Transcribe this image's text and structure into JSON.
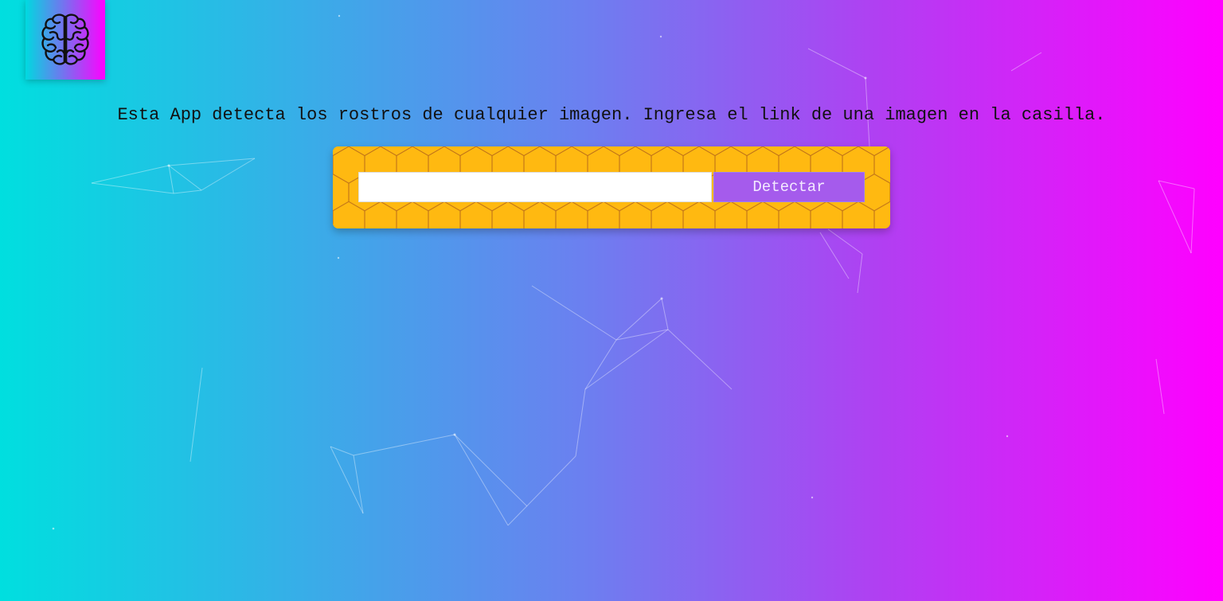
{
  "logo": {
    "icon": "brain-icon"
  },
  "intro_text": "Esta App detecta los rostros de cualquier imagen. Ingresa el link de una imagen en la casilla.",
  "form": {
    "url_value": "",
    "url_placeholder": "",
    "detect_label": "Detectar"
  },
  "colors": {
    "background_start": "#00dfdf",
    "background_end": "#ff00ff",
    "form_background": "#ffb911",
    "button_background": "#a55bec"
  }
}
